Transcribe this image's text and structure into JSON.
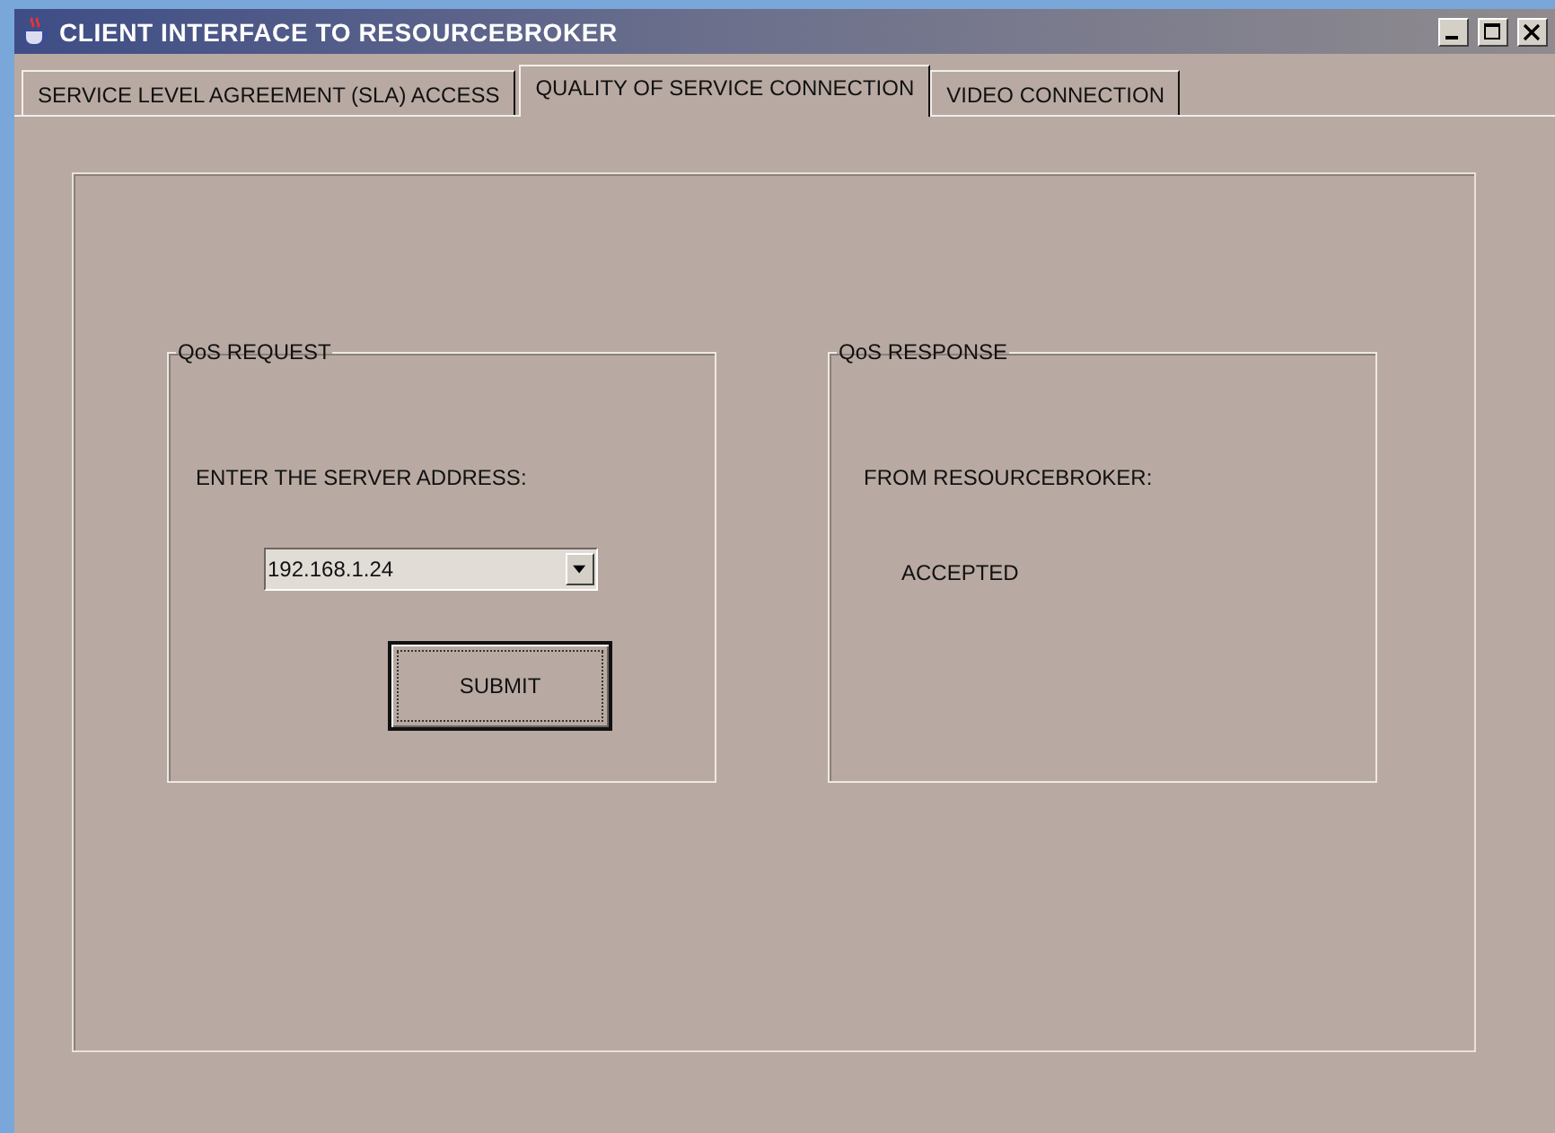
{
  "window": {
    "title": "CLIENT INTERFACE TO RESOURCEBROKER"
  },
  "tabs": [
    {
      "label": "SERVICE LEVEL AGREEMENT (SLA) ACCESS",
      "selected": false
    },
    {
      "label": "QUALITY OF SERVICE CONNECTION",
      "selected": true
    },
    {
      "label": "VIDEO CONNECTION",
      "selected": false
    }
  ],
  "request": {
    "title": "QoS REQUEST",
    "label": "ENTER THE SERVER ADDRESS:",
    "server": "192.168.1.24",
    "button": "SUBMIT"
  },
  "response": {
    "title": "QoS RESPONSE",
    "label": "FROM RESOURCEBROKER:",
    "status": "ACCEPTED"
  }
}
